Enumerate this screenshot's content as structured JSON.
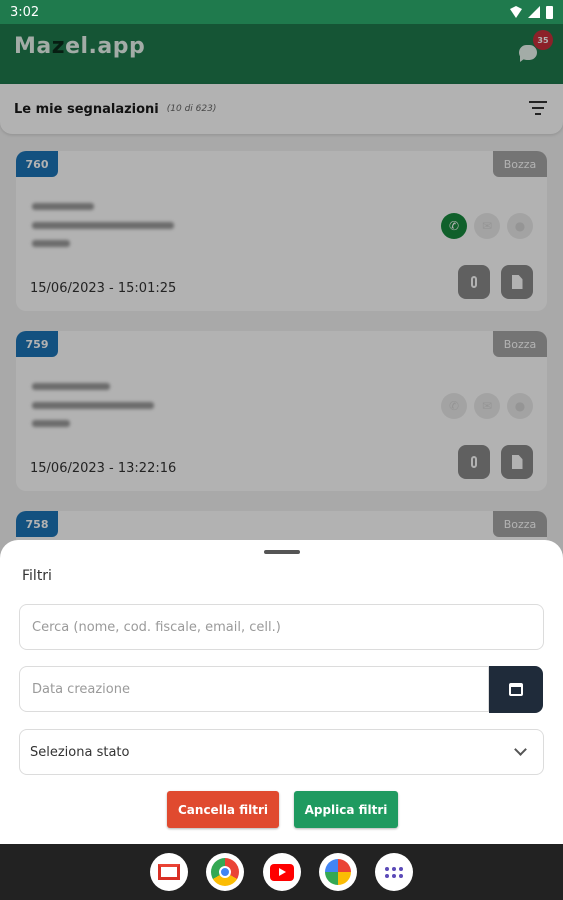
{
  "status_bar": {
    "time": "3:02"
  },
  "app_bar": {
    "brand_prefix": "Ma",
    "brand_z": "z",
    "brand_suffix": "el.app",
    "chat_badge": "35"
  },
  "list_header": {
    "title": "Le mie segnalazioni",
    "count": "(10 di 623)"
  },
  "reports": [
    {
      "id": "760",
      "status": "Bozza",
      "datetime": "15/06/2023 - 15:01:25",
      "phone_active": true
    },
    {
      "id": "759",
      "status": "Bozza",
      "datetime": "15/06/2023 - 13:22:16",
      "phone_active": false
    },
    {
      "id": "758",
      "status": "Bozza"
    }
  ],
  "filters": {
    "title": "Filtri",
    "search_placeholder": "Cerca (nome, cod. fiscale, email, cell.)",
    "date_placeholder": "Data creazione",
    "state_select": "Seleziona stato",
    "cancel_label": "Cancella filtri",
    "apply_label": "Applica filtri"
  },
  "colors": {
    "primary": "#1f7a4d",
    "id_badge": "#1c74b8",
    "cancel": "#e04a2f",
    "apply": "#1f9a60"
  },
  "taskbar": {
    "apps": [
      "gmail-icon",
      "chrome-icon",
      "youtube-icon",
      "photos-icon",
      "app-drawer-icon"
    ]
  }
}
